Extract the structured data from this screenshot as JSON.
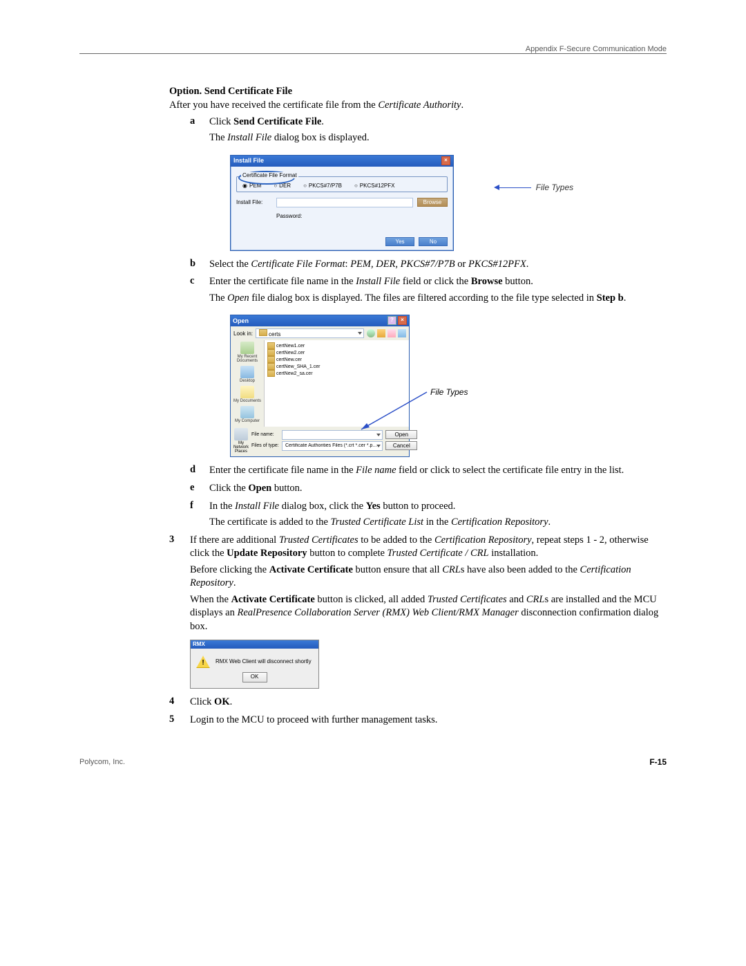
{
  "header": "Appendix F-Secure Communication Mode",
  "section_title": "Option. Send Certificate File",
  "after_received_1": "After you have received the certificate file from the ",
  "after_received_2": "Certificate Authority",
  "after_received_3": ".",
  "step_a": {
    "label": "a",
    "line1a": "Click ",
    "line1b": "Send Certificate File",
    "line1c": ".",
    "line2a": "The ",
    "line2b": "Install File",
    "line2c": " dialog box is displayed."
  },
  "install_dialog": {
    "title": "Install File",
    "group": "Certificate File Format",
    "r1": "PEM",
    "r2": "DER",
    "r3": "PKCS#7/P7B",
    "r4": "PKCS#12PFX",
    "field": "Install File:",
    "browse": "Browse",
    "password": "Password:",
    "yes": "Yes",
    "no": "No"
  },
  "annot_file_types": "File Types",
  "step_b": {
    "label": "b",
    "t1": "Select the ",
    "t2": "Certificate File Format",
    "t3": ": ",
    "t4": "PEM, DER, PKCS#7/P7B",
    "t5": " or ",
    "t6": "PKCS#12PFX",
    "t7": "."
  },
  "step_c": {
    "label": "c",
    "l1a": "Enter the certificate file name in the ",
    "l1b": "Install File",
    "l1c": " field or click the ",
    "l1d": "Browse",
    "l1e": " button.",
    "l2a": "The ",
    "l2b": "Open",
    "l2c": " file dialog box is displayed. The files are filtered according to the file type selected in ",
    "l2d": "Step b",
    "l2e": "."
  },
  "open_dialog": {
    "title": "Open",
    "lookin": "Look in:",
    "folder": "certs",
    "places": {
      "recent": "My Recent Documents",
      "desktop": "Desktop",
      "mydocs": "My Documents",
      "mycomp": "My Computer",
      "mynet": "My Network Places"
    },
    "files": [
      "certNew1.cer",
      "certNew2.cer",
      "certNew.cer",
      "certNew_SHA_1.cer",
      "certNew2_sa.cer"
    ],
    "filename_lbl": "File name:",
    "filetype_lbl": "Files of type:",
    "filetype_val": "Certificate Authorities Files (*.crt *.cer *.p...",
    "open": "Open",
    "cancel": "Cancel"
  },
  "step_d": {
    "label": "d",
    "t1": "Enter the certificate file name in the ",
    "t2": "File name",
    "t3": " field or click to select the certificate file entry in the list."
  },
  "step_e": {
    "label": "e",
    "t1": "Click the ",
    "t2": "Open",
    "t3": " button."
  },
  "step_f": {
    "label": "f",
    "l1a": "In the ",
    "l1b": "Install File",
    "l1c": " dialog box, click the ",
    "l1d": "Yes",
    "l1e": " button to proceed.",
    "l2a": "The certificate is added to the ",
    "l2b": "Trusted Certificate List",
    "l2c": " in the ",
    "l2d": "Certification Repository",
    "l2e": "."
  },
  "step3": {
    "label": "3",
    "p1a": "If there are additional ",
    "p1b": "Trusted Certificates",
    "p1c": " to be added to the ",
    "p1d": "Certification Repository",
    "p1e": ", repeat steps 1 - 2, otherwise click the ",
    "p1f": "Update Repository",
    "p1g": " button to complete ",
    "p1h": "Trusted Certificate / CRL",
    "p1i": " installation.",
    "p2a": "Before clicking the ",
    "p2b": "Activate Certificate",
    "p2c": " button ensure that all ",
    "p2d": "CRL",
    "p2e": "s have also been added to the ",
    "p2f": "Certification Repository",
    "p2g": ".",
    "p3a": "When the ",
    "p3b": "Activate Certificate",
    "p3c": " button is clicked, all added ",
    "p3d": "Trusted Certificates",
    "p3e": " and ",
    "p3f": "CRL",
    "p3g": "s are installed and the MCU displays an ",
    "p3h": "RealPresence Collaboration Server (RMX) Web Client/RMX Manager",
    "p3i": " disconnection confirmation dialog box."
  },
  "msg": {
    "title": "RMX",
    "body": "RMX Web Client will disconnect shortly",
    "ok": "OK"
  },
  "step4": {
    "label": "4",
    "t1": "Click ",
    "t2": "OK",
    "t3": "."
  },
  "step5": {
    "label": "5",
    "t1": "Login to the MCU to proceed with further management tasks."
  },
  "footer": {
    "company": "Polycom, Inc.",
    "page": "F-15"
  }
}
